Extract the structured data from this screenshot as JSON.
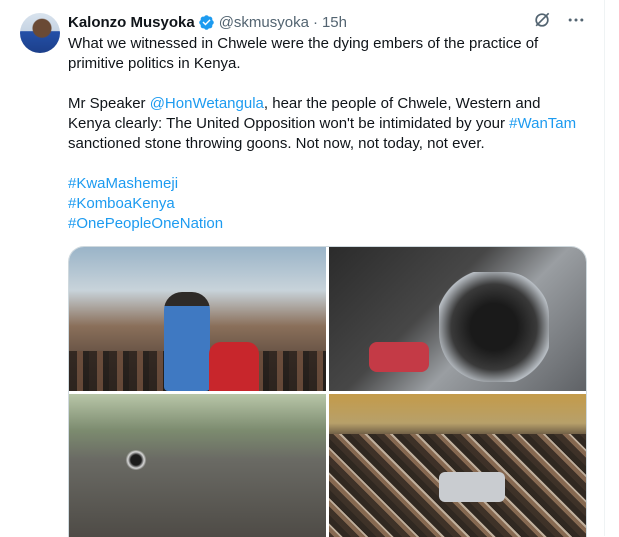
{
  "tweet": {
    "author_name": "Kalonzo Musyoka",
    "handle": "@skmusyoka",
    "separator": "·",
    "time": "15h",
    "paragraph1": "What we witnessed in Chwele were the dying embers of the practice of primitive politics in Kenya.",
    "p2_start": "Mr Speaker ",
    "mention": "@HonWetangula",
    "p2_mid": ", hear the people of Chwele, Western and Kenya clearly: The United Opposition won't be intimidated by your ",
    "hashtag_inline": "#WanTam",
    "p2_end": " sanctioned stone throwing goons. Not now, not today, not ever.",
    "hashtags": [
      "#KwaMashemeji",
      "#KomboaKenya",
      "#OnePeopleOneNation"
    ]
  },
  "icons": {
    "verified": "verified-badge-icon",
    "grok": "grok-icon",
    "more": "more-icon"
  },
  "colors": {
    "link": "#1d9bf0",
    "text": "#0f1419",
    "secondary": "#536471",
    "verified": "#1d9bf0"
  }
}
